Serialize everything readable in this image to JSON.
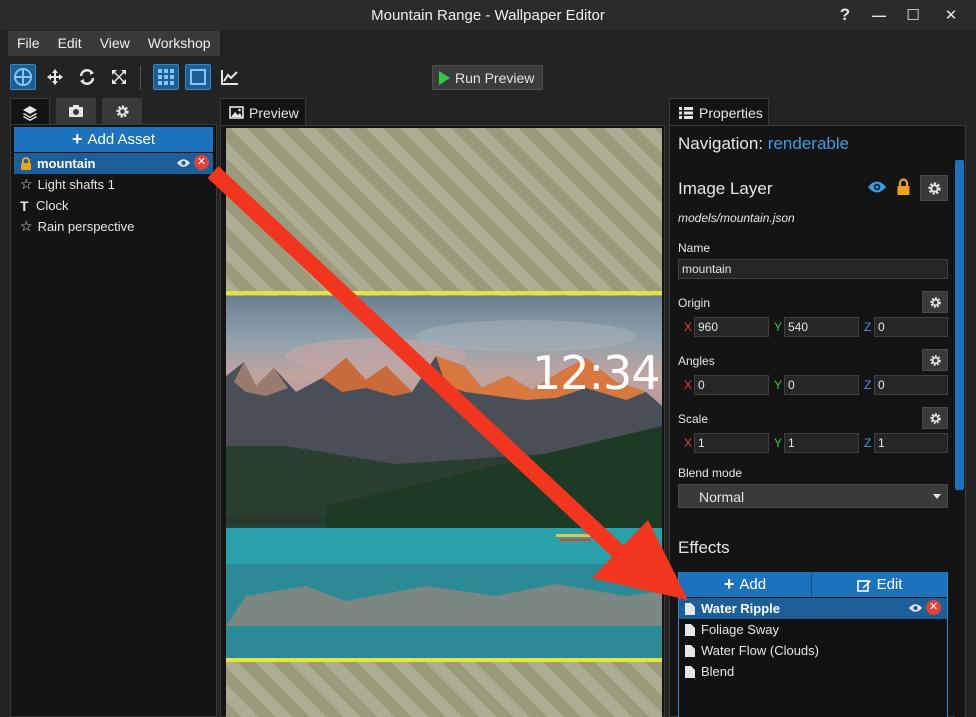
{
  "window": {
    "title": "Mountain Range - Wallpaper Editor",
    "help_glyph": "?",
    "minimize_glyph": "—",
    "maximize_glyph": "☐",
    "close_glyph": "✕"
  },
  "menu": [
    "File",
    "Edit",
    "View",
    "Workshop"
  ],
  "toolbar": {
    "run_preview_label": "Run Preview",
    "tools": [
      "move-gizmo-icon",
      "translate-icon",
      "rotate-icon",
      "scale-icon",
      "grid-icon",
      "frame-icon",
      "graph-icon"
    ]
  },
  "assets": {
    "add_label": "Add Asset",
    "items": [
      {
        "label": "mountain",
        "icon": "lock-icon",
        "selected": true
      },
      {
        "label": "Light shafts 1",
        "icon": "star-icon"
      },
      {
        "label": "Clock",
        "icon": "text-icon"
      },
      {
        "label": "Rain perspective",
        "icon": "star-icon"
      }
    ]
  },
  "preview": {
    "tab_label": "Preview",
    "clock_text": "12:34"
  },
  "properties": {
    "tab_label": "Properties",
    "navigation_label": "Navigation:",
    "navigation_value": "renderable",
    "section_title": "Image Layer",
    "model_path": "models/mountain.json",
    "name_label": "Name",
    "name_value": "mountain",
    "origin": {
      "label": "Origin",
      "x": "960",
      "y": "540",
      "z": "0"
    },
    "angles": {
      "label": "Angles",
      "x": "0",
      "y": "0",
      "z": "0"
    },
    "scale": {
      "label": "Scale",
      "x": "1",
      "y": "1",
      "z": "1"
    },
    "axis_labels": {
      "x": "X",
      "y": "Y",
      "z": "Z"
    },
    "blend_label": "Blend mode",
    "blend_value": "Normal",
    "effects_title": "Effects",
    "add_label": "Add",
    "edit_label": "Edit",
    "effects": [
      {
        "label": "Water Ripple",
        "selected": true
      },
      {
        "label": "Foliage Sway"
      },
      {
        "label": "Water Flow (Clouds)"
      },
      {
        "label": "Blend"
      }
    ],
    "accent_color": "#2f86c8",
    "link_color": "#3a9ce6",
    "lock_color": "#f0a01e"
  }
}
